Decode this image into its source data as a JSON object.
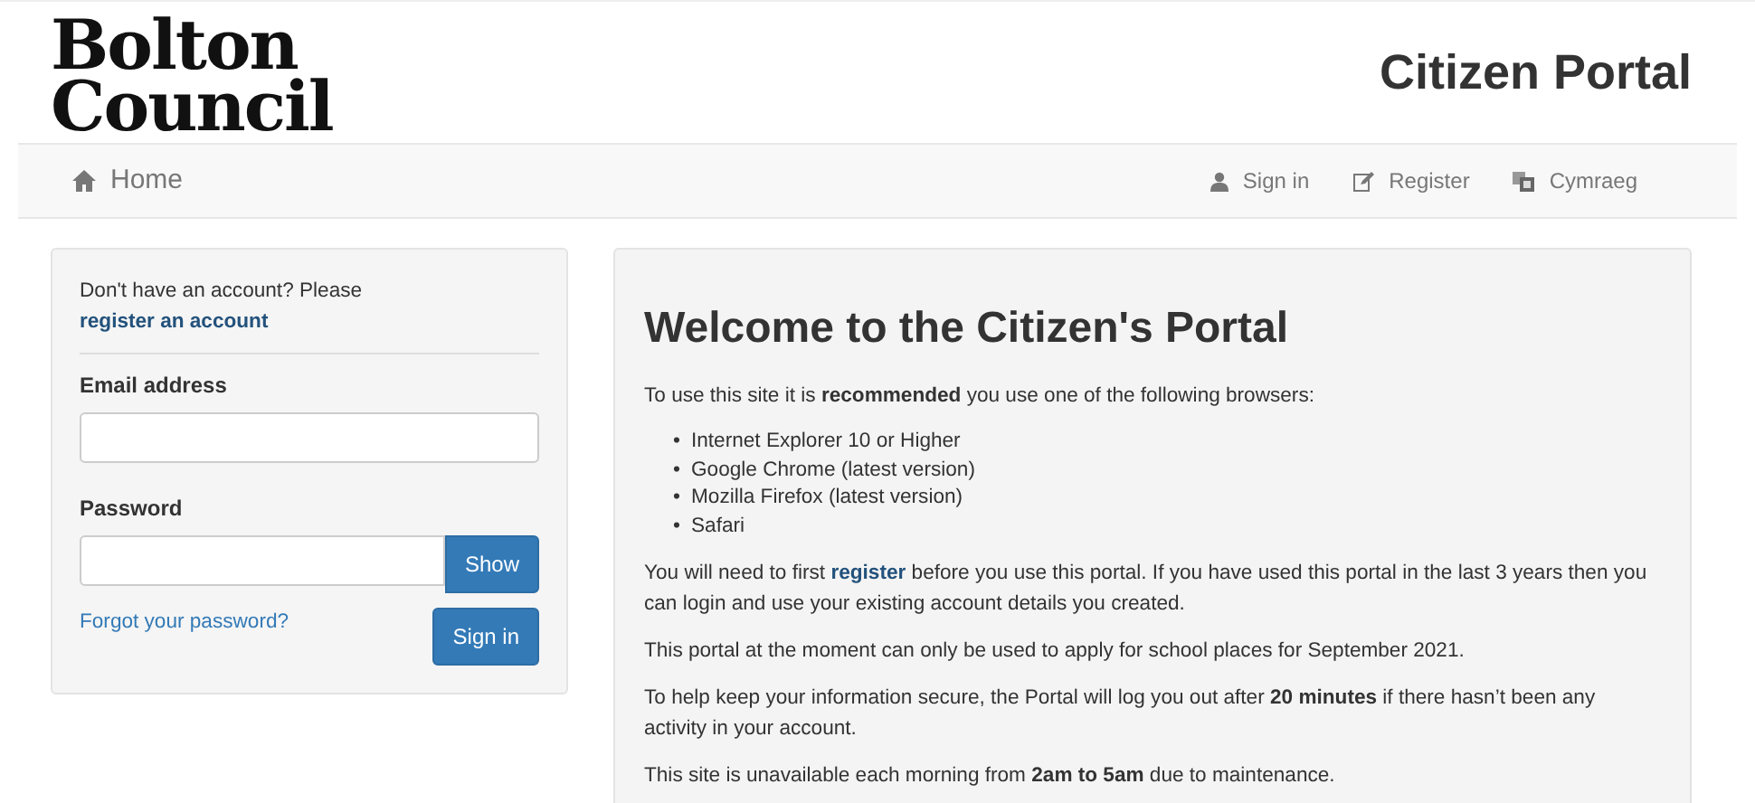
{
  "header": {
    "logo_lines": [
      "Bolton",
      "Council"
    ],
    "title": "Citizen Portal"
  },
  "navbar": {
    "home": "Home",
    "links": [
      {
        "kind": "user",
        "label": "Sign in"
      },
      {
        "kind": "edit",
        "label": "Register"
      },
      {
        "kind": "language",
        "label": "Cymraeg"
      }
    ]
  },
  "login": {
    "intro": [
      {
        "kind": "text",
        "text": "Don't have an account? Please "
      },
      {
        "kind": "link",
        "text": "register an account"
      }
    ],
    "email_label": "Email address",
    "password_label": "Password",
    "show_button": "Show",
    "forgot_link": "Forgot your password?",
    "sign_in_button": "Sign in"
  },
  "welcome": {
    "title": "Welcome to the Citizen's Portal",
    "intro": "To use this site it is **recommended** you use one of the following browsers:",
    "bullet": "•",
    "browsers": [
      "Internet Explorer 10 or Higher",
      "Google Chrome (latest version)",
      "Mozilla Firefox (latest version)",
      "Safari"
    ],
    "paragraphs": [
      [
        {
          "kind": "text",
          "text": "You will need to first "
        },
        {
          "kind": "link",
          "text": "register"
        },
        {
          "kind": "text",
          "text": " before you use this portal. If you have used this portal in the last 3 years then you can login and use your existing account details you created."
        }
      ],
      [
        {
          "kind": "text",
          "text": "This portal at the moment can only be used to apply for school places for September 2021."
        }
      ],
      [
        {
          "kind": "text",
          "text": "To help keep your information secure, the Portal will log you out after **20 minutes** if there hasn’t been any activity in your account."
        }
      ],
      [
        {
          "kind": "text",
          "text": "This site is unavailable each morning from **2am to 5am** due to maintenance."
        }
      ]
    ]
  }
}
